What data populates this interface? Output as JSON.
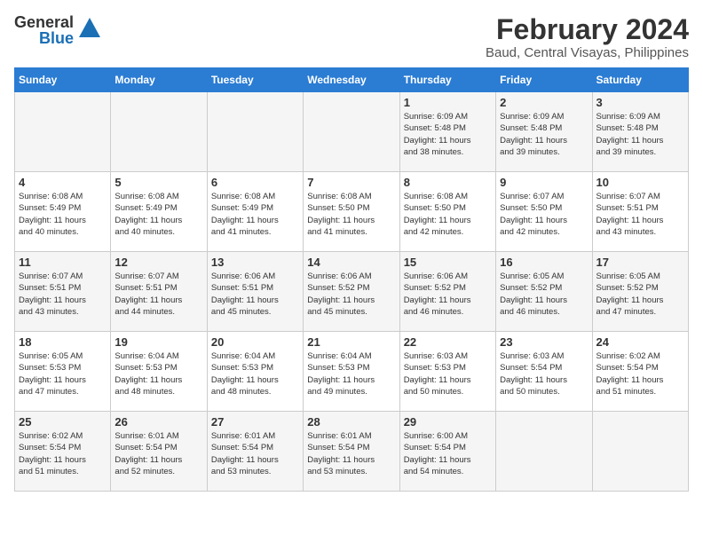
{
  "logo": {
    "general": "General",
    "blue": "Blue"
  },
  "title": {
    "month_year": "February 2024",
    "location": "Baud, Central Visayas, Philippines"
  },
  "days_of_week": [
    "Sunday",
    "Monday",
    "Tuesday",
    "Wednesday",
    "Thursday",
    "Friday",
    "Saturday"
  ],
  "weeks": [
    [
      {
        "day": "",
        "info": ""
      },
      {
        "day": "",
        "info": ""
      },
      {
        "day": "",
        "info": ""
      },
      {
        "day": "",
        "info": ""
      },
      {
        "day": "1",
        "info": "Sunrise: 6:09 AM\nSunset: 5:48 PM\nDaylight: 11 hours\nand 38 minutes."
      },
      {
        "day": "2",
        "info": "Sunrise: 6:09 AM\nSunset: 5:48 PM\nDaylight: 11 hours\nand 39 minutes."
      },
      {
        "day": "3",
        "info": "Sunrise: 6:09 AM\nSunset: 5:48 PM\nDaylight: 11 hours\nand 39 minutes."
      }
    ],
    [
      {
        "day": "4",
        "info": "Sunrise: 6:08 AM\nSunset: 5:49 PM\nDaylight: 11 hours\nand 40 minutes."
      },
      {
        "day": "5",
        "info": "Sunrise: 6:08 AM\nSunset: 5:49 PM\nDaylight: 11 hours\nand 40 minutes."
      },
      {
        "day": "6",
        "info": "Sunrise: 6:08 AM\nSunset: 5:49 PM\nDaylight: 11 hours\nand 41 minutes."
      },
      {
        "day": "7",
        "info": "Sunrise: 6:08 AM\nSunset: 5:50 PM\nDaylight: 11 hours\nand 41 minutes."
      },
      {
        "day": "8",
        "info": "Sunrise: 6:08 AM\nSunset: 5:50 PM\nDaylight: 11 hours\nand 42 minutes."
      },
      {
        "day": "9",
        "info": "Sunrise: 6:07 AM\nSunset: 5:50 PM\nDaylight: 11 hours\nand 42 minutes."
      },
      {
        "day": "10",
        "info": "Sunrise: 6:07 AM\nSunset: 5:51 PM\nDaylight: 11 hours\nand 43 minutes."
      }
    ],
    [
      {
        "day": "11",
        "info": "Sunrise: 6:07 AM\nSunset: 5:51 PM\nDaylight: 11 hours\nand 43 minutes."
      },
      {
        "day": "12",
        "info": "Sunrise: 6:07 AM\nSunset: 5:51 PM\nDaylight: 11 hours\nand 44 minutes."
      },
      {
        "day": "13",
        "info": "Sunrise: 6:06 AM\nSunset: 5:51 PM\nDaylight: 11 hours\nand 45 minutes."
      },
      {
        "day": "14",
        "info": "Sunrise: 6:06 AM\nSunset: 5:52 PM\nDaylight: 11 hours\nand 45 minutes."
      },
      {
        "day": "15",
        "info": "Sunrise: 6:06 AM\nSunset: 5:52 PM\nDaylight: 11 hours\nand 46 minutes."
      },
      {
        "day": "16",
        "info": "Sunrise: 6:05 AM\nSunset: 5:52 PM\nDaylight: 11 hours\nand 46 minutes."
      },
      {
        "day": "17",
        "info": "Sunrise: 6:05 AM\nSunset: 5:52 PM\nDaylight: 11 hours\nand 47 minutes."
      }
    ],
    [
      {
        "day": "18",
        "info": "Sunrise: 6:05 AM\nSunset: 5:53 PM\nDaylight: 11 hours\nand 47 minutes."
      },
      {
        "day": "19",
        "info": "Sunrise: 6:04 AM\nSunset: 5:53 PM\nDaylight: 11 hours\nand 48 minutes."
      },
      {
        "day": "20",
        "info": "Sunrise: 6:04 AM\nSunset: 5:53 PM\nDaylight: 11 hours\nand 48 minutes."
      },
      {
        "day": "21",
        "info": "Sunrise: 6:04 AM\nSunset: 5:53 PM\nDaylight: 11 hours\nand 49 minutes."
      },
      {
        "day": "22",
        "info": "Sunrise: 6:03 AM\nSunset: 5:53 PM\nDaylight: 11 hours\nand 50 minutes."
      },
      {
        "day": "23",
        "info": "Sunrise: 6:03 AM\nSunset: 5:54 PM\nDaylight: 11 hours\nand 50 minutes."
      },
      {
        "day": "24",
        "info": "Sunrise: 6:02 AM\nSunset: 5:54 PM\nDaylight: 11 hours\nand 51 minutes."
      }
    ],
    [
      {
        "day": "25",
        "info": "Sunrise: 6:02 AM\nSunset: 5:54 PM\nDaylight: 11 hours\nand 51 minutes."
      },
      {
        "day": "26",
        "info": "Sunrise: 6:01 AM\nSunset: 5:54 PM\nDaylight: 11 hours\nand 52 minutes."
      },
      {
        "day": "27",
        "info": "Sunrise: 6:01 AM\nSunset: 5:54 PM\nDaylight: 11 hours\nand 53 minutes."
      },
      {
        "day": "28",
        "info": "Sunrise: 6:01 AM\nSunset: 5:54 PM\nDaylight: 11 hours\nand 53 minutes."
      },
      {
        "day": "29",
        "info": "Sunrise: 6:00 AM\nSunset: 5:54 PM\nDaylight: 11 hours\nand 54 minutes."
      },
      {
        "day": "",
        "info": ""
      },
      {
        "day": "",
        "info": ""
      }
    ]
  ]
}
